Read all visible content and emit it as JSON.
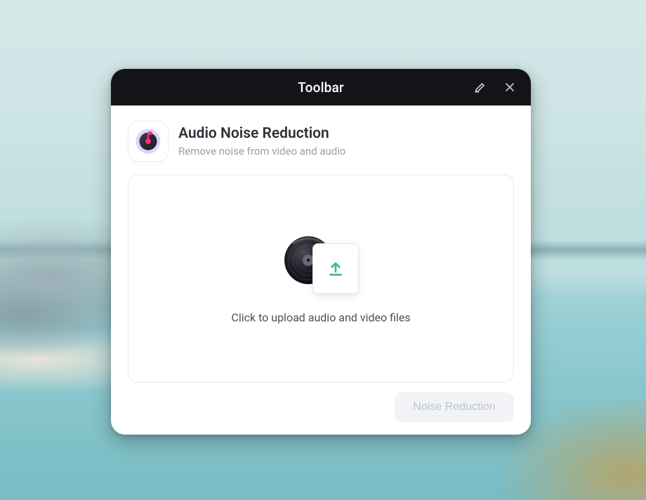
{
  "window": {
    "title": "Toolbar"
  },
  "header": {
    "title": "Audio Noise Reduction",
    "subtitle": "Remove noise from video and audio"
  },
  "dropzone": {
    "prompt": "Click to upload audio and video files"
  },
  "actions": {
    "primary_label": "Noise Reduction"
  },
  "colors": {
    "accent_green": "#2fbf87",
    "accent_pink": "#ff2e74",
    "accent_purple": "#a78bff"
  }
}
